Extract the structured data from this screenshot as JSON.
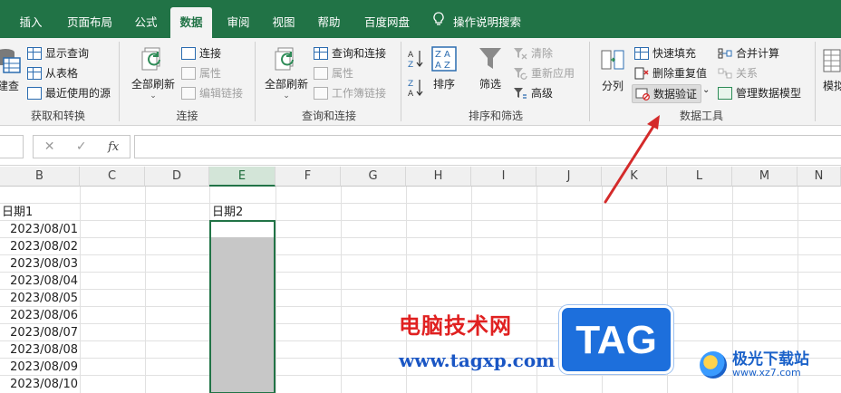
{
  "tabs": [
    "插入",
    "页面布局",
    "公式",
    "数据",
    "审阅",
    "视图",
    "帮助",
    "百度网盘"
  ],
  "active_tab": "数据",
  "tell_me": "操作说明搜索",
  "ribbon": {
    "get_transform": {
      "label": "获取和转换",
      "new_query_label": "建查",
      "items": [
        "显示查询",
        "从表格",
        "最近使用的源"
      ]
    },
    "connections": {
      "label": "连接",
      "refresh_all": "全部刷新",
      "items": [
        "连接",
        "属性",
        "编辑链接"
      ]
    },
    "queries": {
      "label": "查询和连接",
      "refresh_all": "全部刷新",
      "items": [
        "查询和连接",
        "属性",
        "工作簿链接"
      ]
    },
    "sort_filter": {
      "label": "排序和筛选",
      "sort": "排序",
      "filter": "筛选",
      "items": [
        "清除",
        "重新应用",
        "高级"
      ]
    },
    "data_tools": {
      "label": "数据工具",
      "text_to_columns": "分列",
      "items": [
        "快速填充",
        "删除重复值",
        "数据验证",
        "合并计算",
        "关系",
        "管理数据模型"
      ]
    },
    "forecast": {
      "what_if": "模拟"
    }
  },
  "formula_bar": {
    "cancel": "✕",
    "enter": "✓",
    "fx": "fx",
    "value": ""
  },
  "columns": [
    "B",
    "C",
    "D",
    "E",
    "F",
    "G",
    "H",
    "I",
    "J",
    "K",
    "L",
    "M",
    "N"
  ],
  "selected_column": "E",
  "cells": {
    "b_header": "日期1",
    "e_header": "日期2",
    "b_values": [
      "2023/08/01",
      "2023/08/02",
      "2023/08/03",
      "2023/08/04",
      "2023/08/05",
      "2023/08/06",
      "2023/08/07",
      "2023/08/08",
      "2023/08/09",
      "2023/08/10"
    ]
  },
  "watermarks": {
    "site_cn": "电脑技术网",
    "site_url": "www.tagxp.com",
    "logo_text": "TAG",
    "jg_name": "极光下载站",
    "jg_url": "www.xz7.com"
  },
  "colors": {
    "excel_green": "#217346",
    "arrow_red": "#d42a2a"
  }
}
